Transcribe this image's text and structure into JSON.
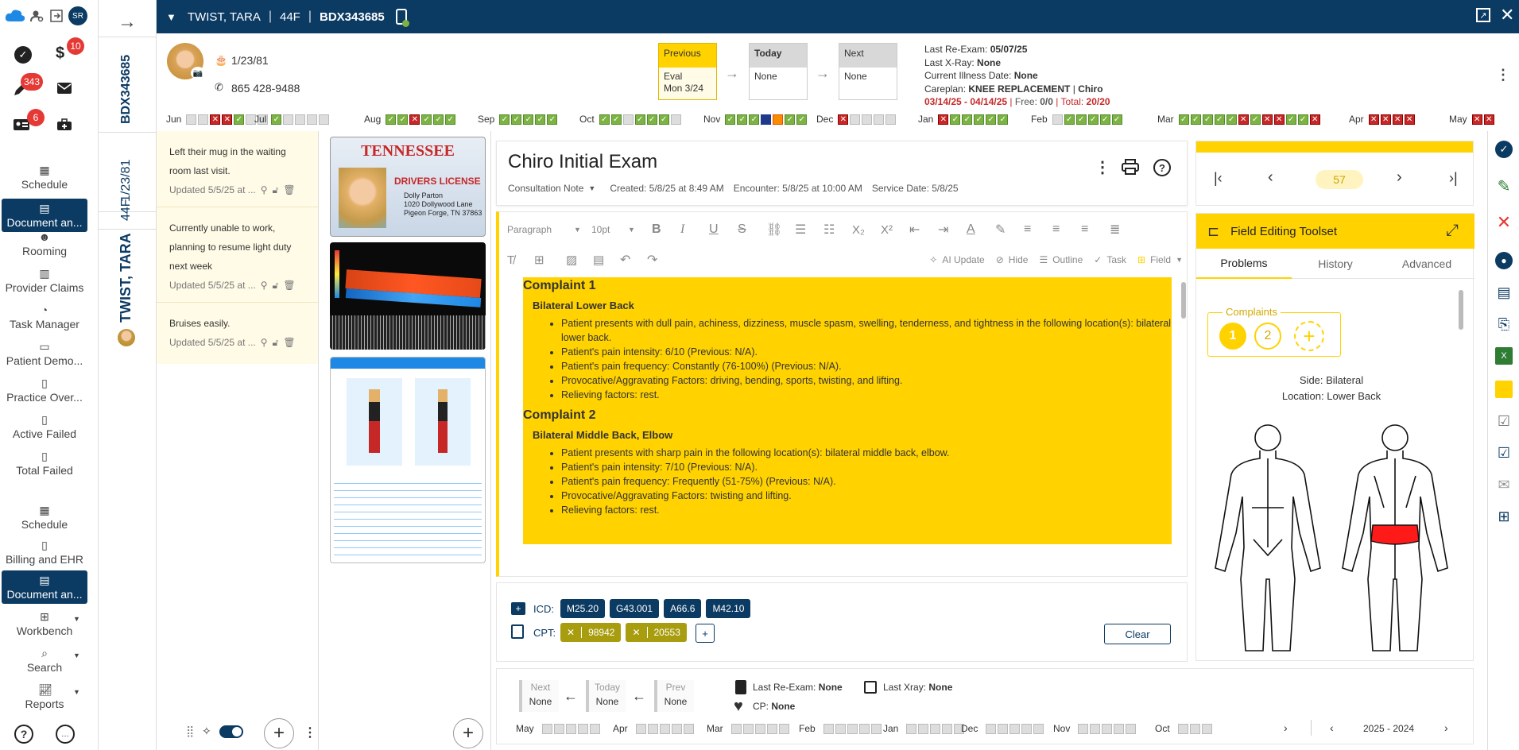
{
  "app": {
    "user_initials": "SR",
    "badges": {
      "billing": "10",
      "pen": "343",
      "card": "6"
    }
  },
  "nav": {
    "items": [
      {
        "label": "Schedule",
        "icon": "calendar-icon",
        "active": false
      },
      {
        "label": "Document an...",
        "icon": "document-icon",
        "active": true
      },
      {
        "label": "Rooming",
        "icon": "people-icon",
        "active": false
      },
      {
        "label": "Provider Claims",
        "icon": "claims-icon",
        "active": false
      },
      {
        "label": "Task Manager",
        "icon": "task-icon",
        "active": false
      },
      {
        "label": "Patient Demo...",
        "icon": "id-card-icon",
        "active": false
      },
      {
        "label": "Practice Over...",
        "icon": "file-icon",
        "active": false
      },
      {
        "label": "Active Failed",
        "icon": "file-icon",
        "active": false
      },
      {
        "label": "Total Failed",
        "icon": "file-icon",
        "active": false
      },
      {
        "label": "Schedule",
        "icon": "calendar-icon",
        "active": false
      },
      {
        "label": "Billing and EHR",
        "icon": "file-icon",
        "active": false
      },
      {
        "label": "Document an...",
        "icon": "document-icon",
        "active": true
      },
      {
        "label": "Workbench",
        "icon": "workbench-icon",
        "active": false
      },
      {
        "label": "Search",
        "icon": "search-icon",
        "active": false
      },
      {
        "label": "Reports",
        "icon": "chart-icon",
        "active": false
      }
    ]
  },
  "patient": {
    "name": "TWIST, TARA",
    "age_sex": "44F",
    "id": "BDX343685",
    "dob": "1/23/81",
    "phone": "865 428-9488"
  },
  "visits": {
    "previous_label": "Previous",
    "previous_value": "Eval\nMon 3/24",
    "today_label": "Today",
    "today_value": "None",
    "next_label": "Next",
    "next_value": "None"
  },
  "summary": {
    "last_reexam_label": "Last Re-Exam:",
    "last_reexam": "05/07/25",
    "last_xray_label": "Last X-Ray:",
    "last_xray": "None",
    "illness_label": "Current Illness Date:",
    "illness": "None",
    "careplan_label": "Careplan:",
    "careplan": "KNEE REPLACEMENT",
    "careplan_type": "Chiro",
    "careplan_dates": "03/14/25 - 04/14/25",
    "free_label": "Free:",
    "free": "0/0",
    "total_label": "Total:",
    "total": "20/20"
  },
  "timeline": {
    "months": [
      {
        "m": "Jun",
        "s": "eerrgee"
      },
      {
        "m": "Jul",
        "s": "geeee"
      },
      {
        "m": "Aug",
        "s": "ggrggg"
      },
      {
        "m": "Sep",
        "s": "ggggg"
      },
      {
        "m": "Oct",
        "s": "ggeggge"
      },
      {
        "m": "Nov",
        "s": "gggbogg"
      },
      {
        "m": "Dec",
        "s": "reeee"
      },
      {
        "m": "Jan",
        "s": "rggggg"
      },
      {
        "m": "Feb",
        "s": "eggggg"
      },
      {
        "m": "Mar",
        "s": "gggggrgrrggr"
      },
      {
        "m": "Apr",
        "s": "rrrr"
      },
      {
        "m": "May",
        "s": "rr"
      }
    ]
  },
  "notes": [
    {
      "text": "Left their mug in the waiting room last visit.",
      "updated": "Updated 5/5/25 at ..."
    },
    {
      "text": "Currently unable to work, planning to resume light duty next week",
      "updated": "Updated 5/5/25 at ..."
    },
    {
      "text": "Bruises easily.",
      "updated": "Updated 5/5/25 at ..."
    }
  ],
  "license": {
    "state": "TENNESSEE",
    "title": "DRIVERS LICENSE",
    "name": "Dolly Parton",
    "addr1": "1020 Dollywood Lane",
    "addr2": "Pigeon Forge, TN 37863"
  },
  "document": {
    "title": "Chiro Initial Exam",
    "type": "Consultation Note",
    "created": "Created: 5/8/25 at 8:49 AM",
    "encounter": "Encounter: 5/8/25 at 10:00 AM",
    "service": "Service Date: 5/8/25"
  },
  "editor": {
    "paragraph": "Paragraph",
    "fontsize": "10pt",
    "ai_update": "AI Update",
    "hide": "Hide",
    "outline": "Outline",
    "task": "Task",
    "field": "Field"
  },
  "complaints": [
    {
      "heading": "Complaint 1",
      "title": "Bilateral Lower Back",
      "bullets": [
        "Patient presents with dull pain, achiness, dizziness, muscle spasm, swelling, tenderness, and tightness in the following location(s): bilateral lower back.",
        "Patient's pain intensity: 6/10 (Previous: N/A).",
        "Patient's pain frequency: Constantly (76-100%) (Previous: N/A).",
        "Provocative/Aggravating Factors: driving, bending, sports, twisting, and lifting.",
        "Relieving factors: rest."
      ]
    },
    {
      "heading": "Complaint 2",
      "title": "Bilateral Middle Back, Elbow",
      "bullets": [
        "Patient presents with sharp pain in the following location(s): bilateral middle back, elbow.",
        "Patient's pain intensity: 7/10 (Previous: N/A).",
        "Patient's pain frequency: Frequently (51-75%) (Previous: N/A).",
        "Provocative/Aggravating Factors: twisting and lifting.",
        "Relieving factors: rest."
      ]
    }
  ],
  "codes": {
    "icd_label": "ICD:",
    "icd": [
      "M25.20",
      "G43.001",
      "A66.6",
      "M42.10"
    ],
    "cpt_label": "CPT:",
    "cpt": [
      "98942",
      "20553"
    ],
    "clear": "Clear",
    "add": "+"
  },
  "pager": {
    "current": "57"
  },
  "toolset": {
    "title": "Field Editing Toolset",
    "tabs": [
      "Problems",
      "History",
      "Advanced"
    ],
    "complaints_label": "Complaints",
    "c1": "1",
    "c2": "2",
    "side": "Side: Bilateral",
    "location": "Location: Lower Back"
  },
  "bottom": {
    "next": "Next",
    "next_v": "None",
    "today": "Today",
    "today_v": "None",
    "prev": "Prev",
    "prev_v": "None",
    "reexam_label": "Last Re-Exam:",
    "reexam": "None",
    "xray_label": "Last Xray:",
    "xray": "None",
    "cp_label": "CP:",
    "cp": "None",
    "months": [
      "May",
      "Apr",
      "Mar",
      "Feb",
      "Jan",
      "Dec",
      "Nov",
      "Oct"
    ],
    "range": "2025 - 2024"
  },
  "colors": {
    "navy": "#0b3a63",
    "yellow": "#ffd200",
    "red": "#e53935",
    "green": "#7cb342"
  }
}
